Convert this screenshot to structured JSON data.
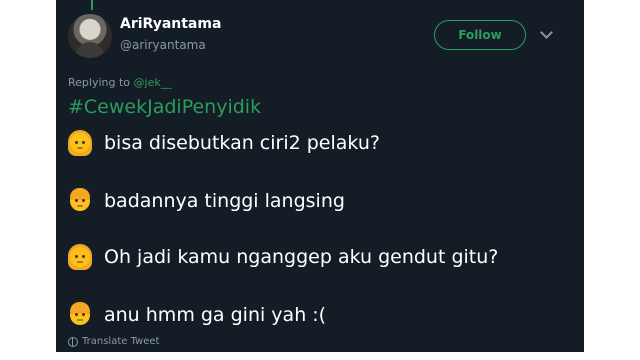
{
  "tweet": {
    "author": {
      "name": "AriRyantama",
      "handle": "@ariryantama",
      "avatar_icon": "user-avatar"
    },
    "follow_label": "Follow",
    "replying_prefix": "Replying to",
    "replying_mention": "@jek__",
    "hashtag": "#CewekJadiPenyidik",
    "lines": [
      {
        "emoji": "woman-face-icon",
        "text": "bisa disebutkan ciri2 pelaku?"
      },
      {
        "emoji": "man-face-icon",
        "text": "badannya tinggi langsing"
      },
      {
        "emoji": "woman-face-icon",
        "text": "Oh jadi kamu nganggep aku gendut gitu?"
      },
      {
        "emoji": "man-face-icon",
        "text": "anu hmm ga gini yah :("
      }
    ],
    "translate_label": "Translate Tweet"
  },
  "colors": {
    "background": "#141d26",
    "accent": "#2a9d5c",
    "muted": "#8899a6"
  }
}
